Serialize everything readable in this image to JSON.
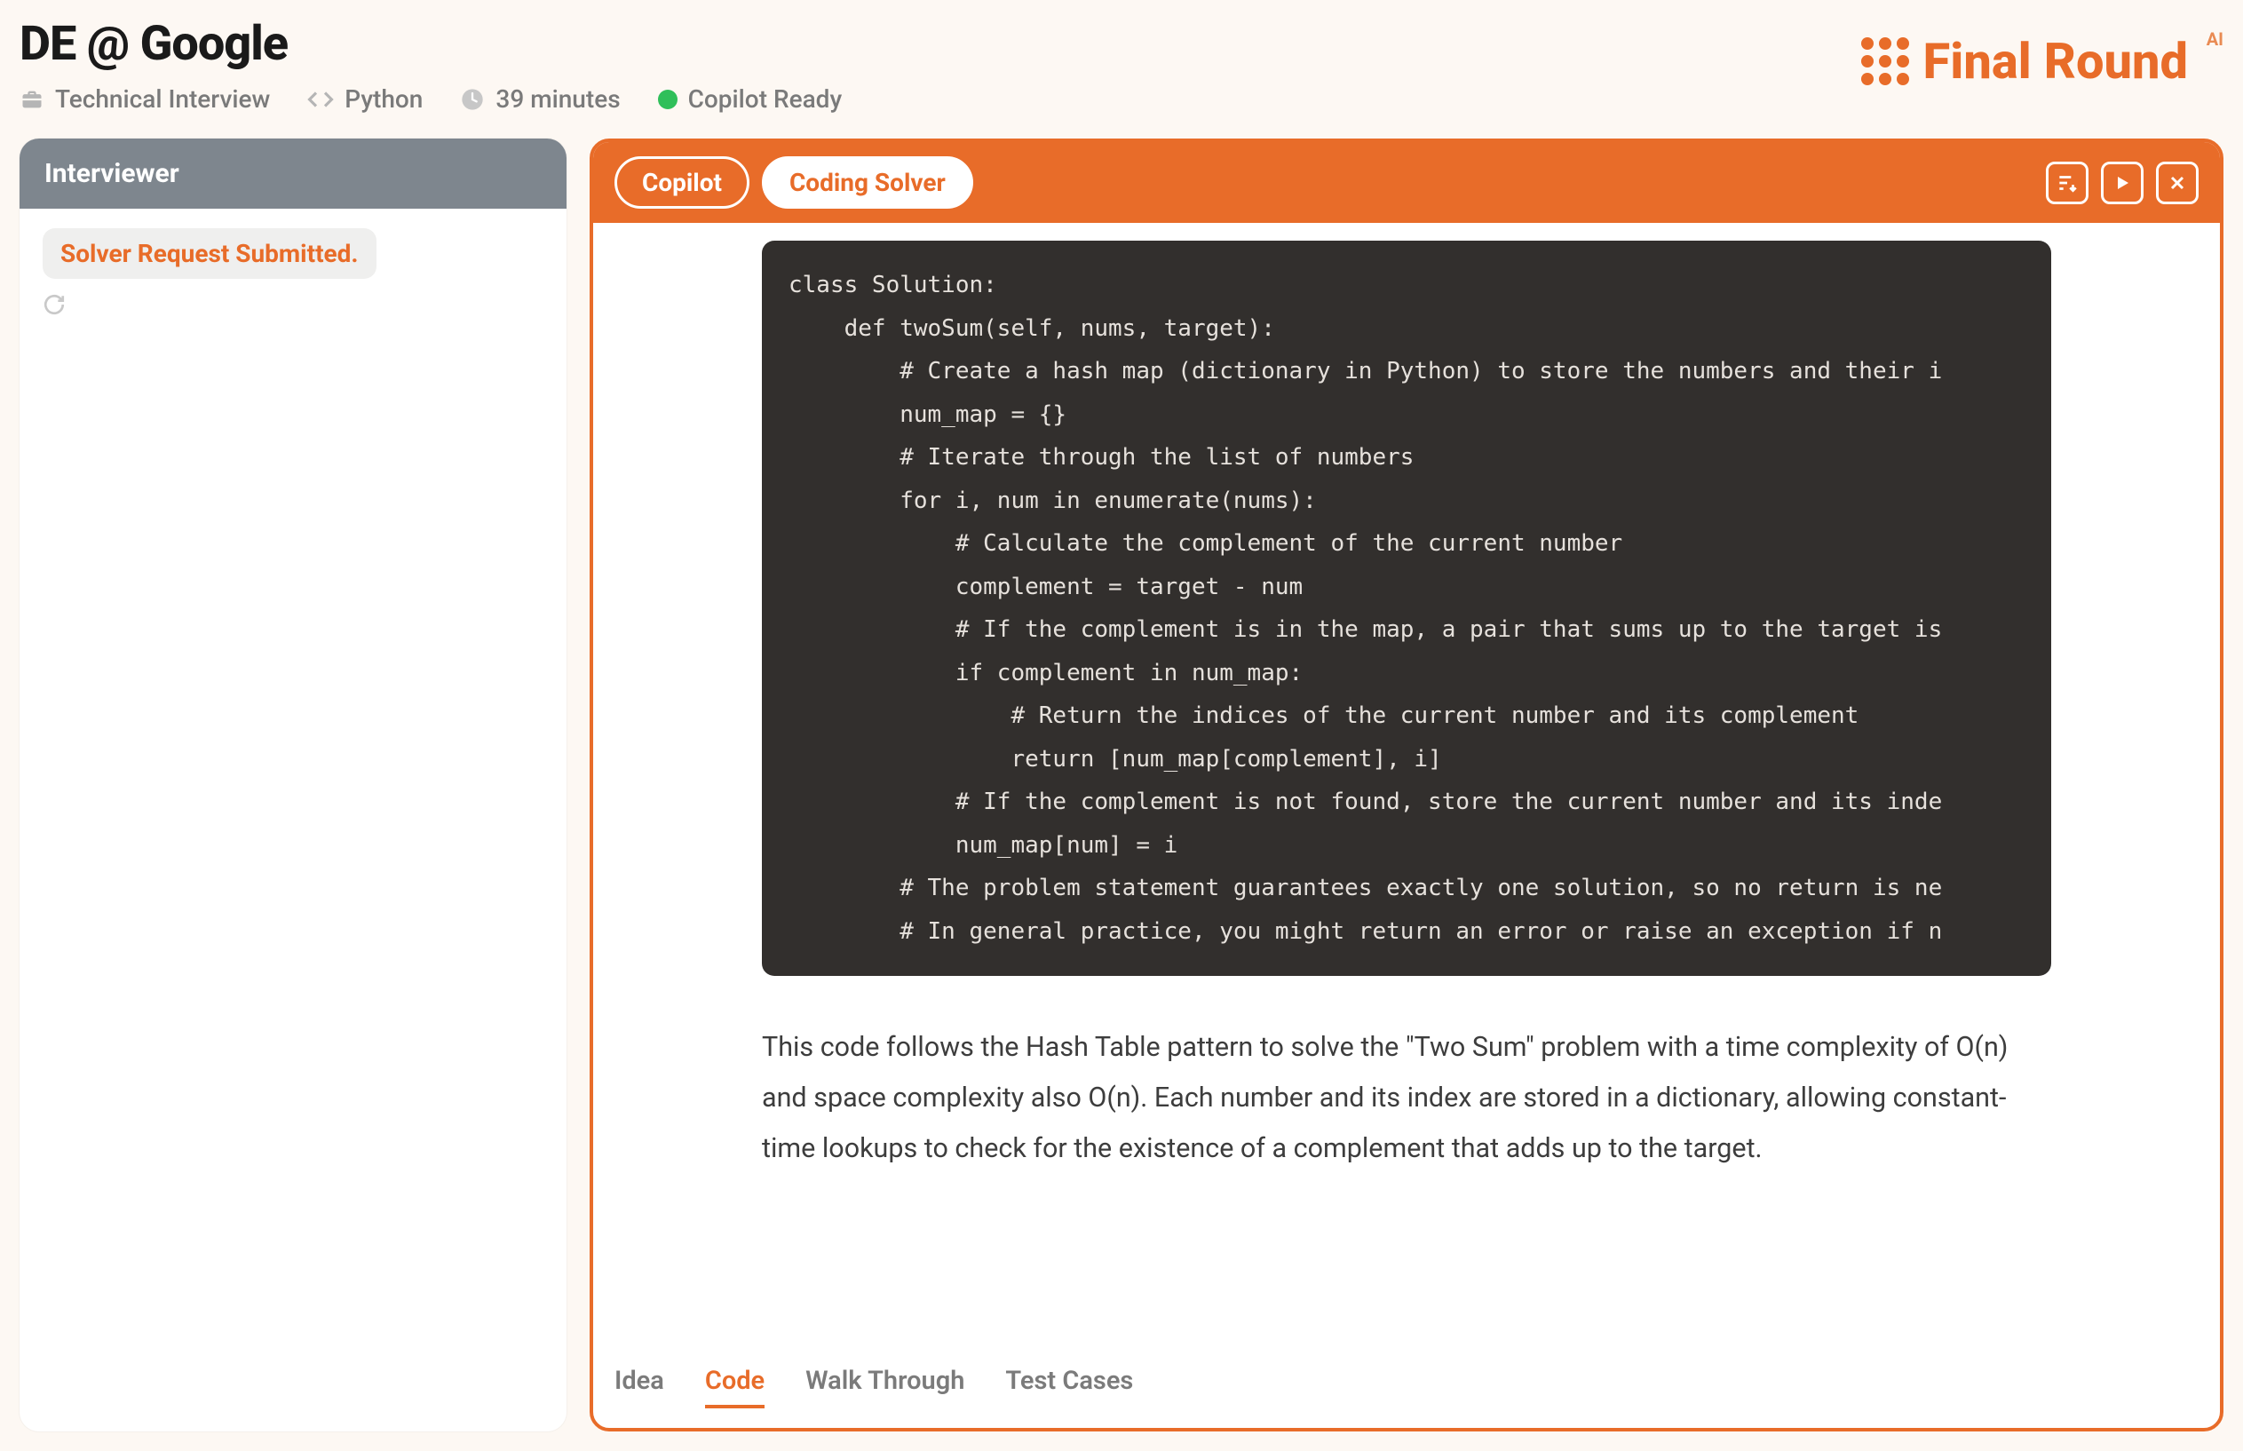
{
  "header": {
    "title": "DE @ Google",
    "interview_type": "Technical Interview",
    "language": "Python",
    "duration": "39 minutes",
    "copilot_status": "Copilot Ready"
  },
  "brand": {
    "name": "Final Round",
    "suffix": "AI"
  },
  "sidebar": {
    "title": "Interviewer",
    "solver_msg": "Solver Request Submitted."
  },
  "panel": {
    "tabs_top": {
      "copilot": "Copilot",
      "coding_solver": "Coding Solver"
    },
    "code": "class Solution:\n    def twoSum(self, nums, target):\n        # Create a hash map (dictionary in Python) to store the numbers and their i\n        num_map = {}\n        # Iterate through the list of numbers\n        for i, num in enumerate(nums):\n            # Calculate the complement of the current number\n            complement = target - num\n            # If the complement is in the map, a pair that sums up to the target is\n            if complement in num_map:\n                # Return the indices of the current number and its complement\n                return [num_map[complement], i]\n            # If the complement is not found, store the current number and its inde\n            num_map[num] = i\n        # The problem statement guarantees exactly one solution, so no return is ne\n        # In general practice, you might return an error or raise an exception if n",
    "explanation": "This code follows the Hash Table pattern to solve the \"Two Sum\" problem with a time complexity of O(n) and space complexity also O(n). Each number and its index are stored in a dictionary, allowing constant-time lookups to check for the existence of a complement that adds up to the target.",
    "bottom_tabs": {
      "idea": "Idea",
      "code": "Code",
      "walkthrough": "Walk Through",
      "testcases": "Test Cases"
    },
    "active_bottom_tab": "code"
  },
  "colors": {
    "accent": "#e86c29",
    "sidebar_header": "#7e868e",
    "status_green": "#2fbf5a",
    "code_bg": "#322f2d"
  }
}
